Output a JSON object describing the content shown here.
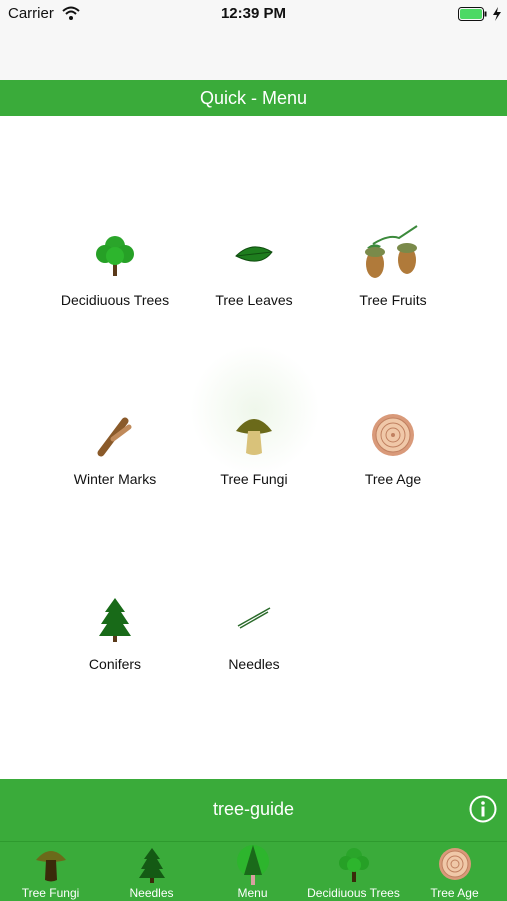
{
  "status_bar": {
    "carrier": "Carrier",
    "time": "12:39 PM"
  },
  "header": {
    "title": "Quick - Menu"
  },
  "menu": {
    "items": [
      {
        "label": "Decidiuous Trees",
        "icon": "deciduous-tree-icon"
      },
      {
        "label": "Tree Leaves",
        "icon": "leaf-icon"
      },
      {
        "label": "Tree Fruits",
        "icon": "acorn-icon"
      },
      {
        "label": "Winter Marks",
        "icon": "twig-icon"
      },
      {
        "label": "Tree Fungi",
        "icon": "mushroom-icon"
      },
      {
        "label": "Tree Age",
        "icon": "tree-rings-icon"
      },
      {
        "label": "Conifers",
        "icon": "conifer-icon"
      },
      {
        "label": "Needles",
        "icon": "needles-icon"
      }
    ]
  },
  "footer": {
    "title": "tree-guide",
    "info_icon": "info-icon"
  },
  "tabs": [
    {
      "label": "Tree Fungi",
      "icon": "mushroom-icon"
    },
    {
      "label": "Needles",
      "icon": "conifer-icon"
    },
    {
      "label": "Menu",
      "icon": "menu-tree-icon"
    },
    {
      "label": "Decidiuous Trees",
      "icon": "deciduous-tree-icon"
    },
    {
      "label": "Tree Age",
      "icon": "tree-rings-icon"
    }
  ],
  "colors": {
    "accent_green": "#3aab3a",
    "status_bar_bg": "#f7f7f7",
    "battery_green": "#4cd964"
  }
}
